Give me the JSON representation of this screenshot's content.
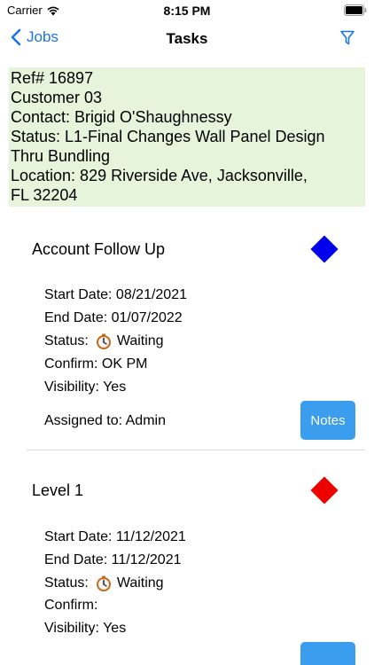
{
  "status_bar": {
    "carrier": "Carrier",
    "time": "8:15 PM"
  },
  "nav": {
    "back_label": "Jobs",
    "title": "Tasks"
  },
  "job": {
    "lines": [
      "Ref# 16897",
      "Customer 03",
      "Contact: Brigid O'Shaughnessy",
      "Status: L1-Final Changes Wall Panel Design",
      "Thru Bundling",
      "Location: 829 Riverside Ave, Jacksonville,",
      "FL 32204"
    ]
  },
  "tasks": [
    {
      "title": "Account Follow Up",
      "diamond_color": "#0000ee",
      "start": "Start Date: 08/21/2021",
      "end": "End Date: 01/07/2022",
      "status_label": "Status:",
      "status_value": "Waiting",
      "confirm": "Confirm: OK PM",
      "visibility": "Visibility: Yes",
      "assigned": "Assigned to: Admin",
      "notes_label": "Notes"
    },
    {
      "title": "Level 1",
      "diamond_color": "#ee0000",
      "start": "Start Date: 11/12/2021",
      "end": "End Date: 11/12/2021",
      "status_label": "Status:",
      "status_value": "Waiting",
      "confirm": "Confirm:",
      "visibility": "Visibility: Yes",
      "notes_label": ""
    }
  ],
  "colors": {
    "accent": "#1a73e8",
    "job_bg": "#e6f4dc",
    "button": "#3a9ded"
  }
}
